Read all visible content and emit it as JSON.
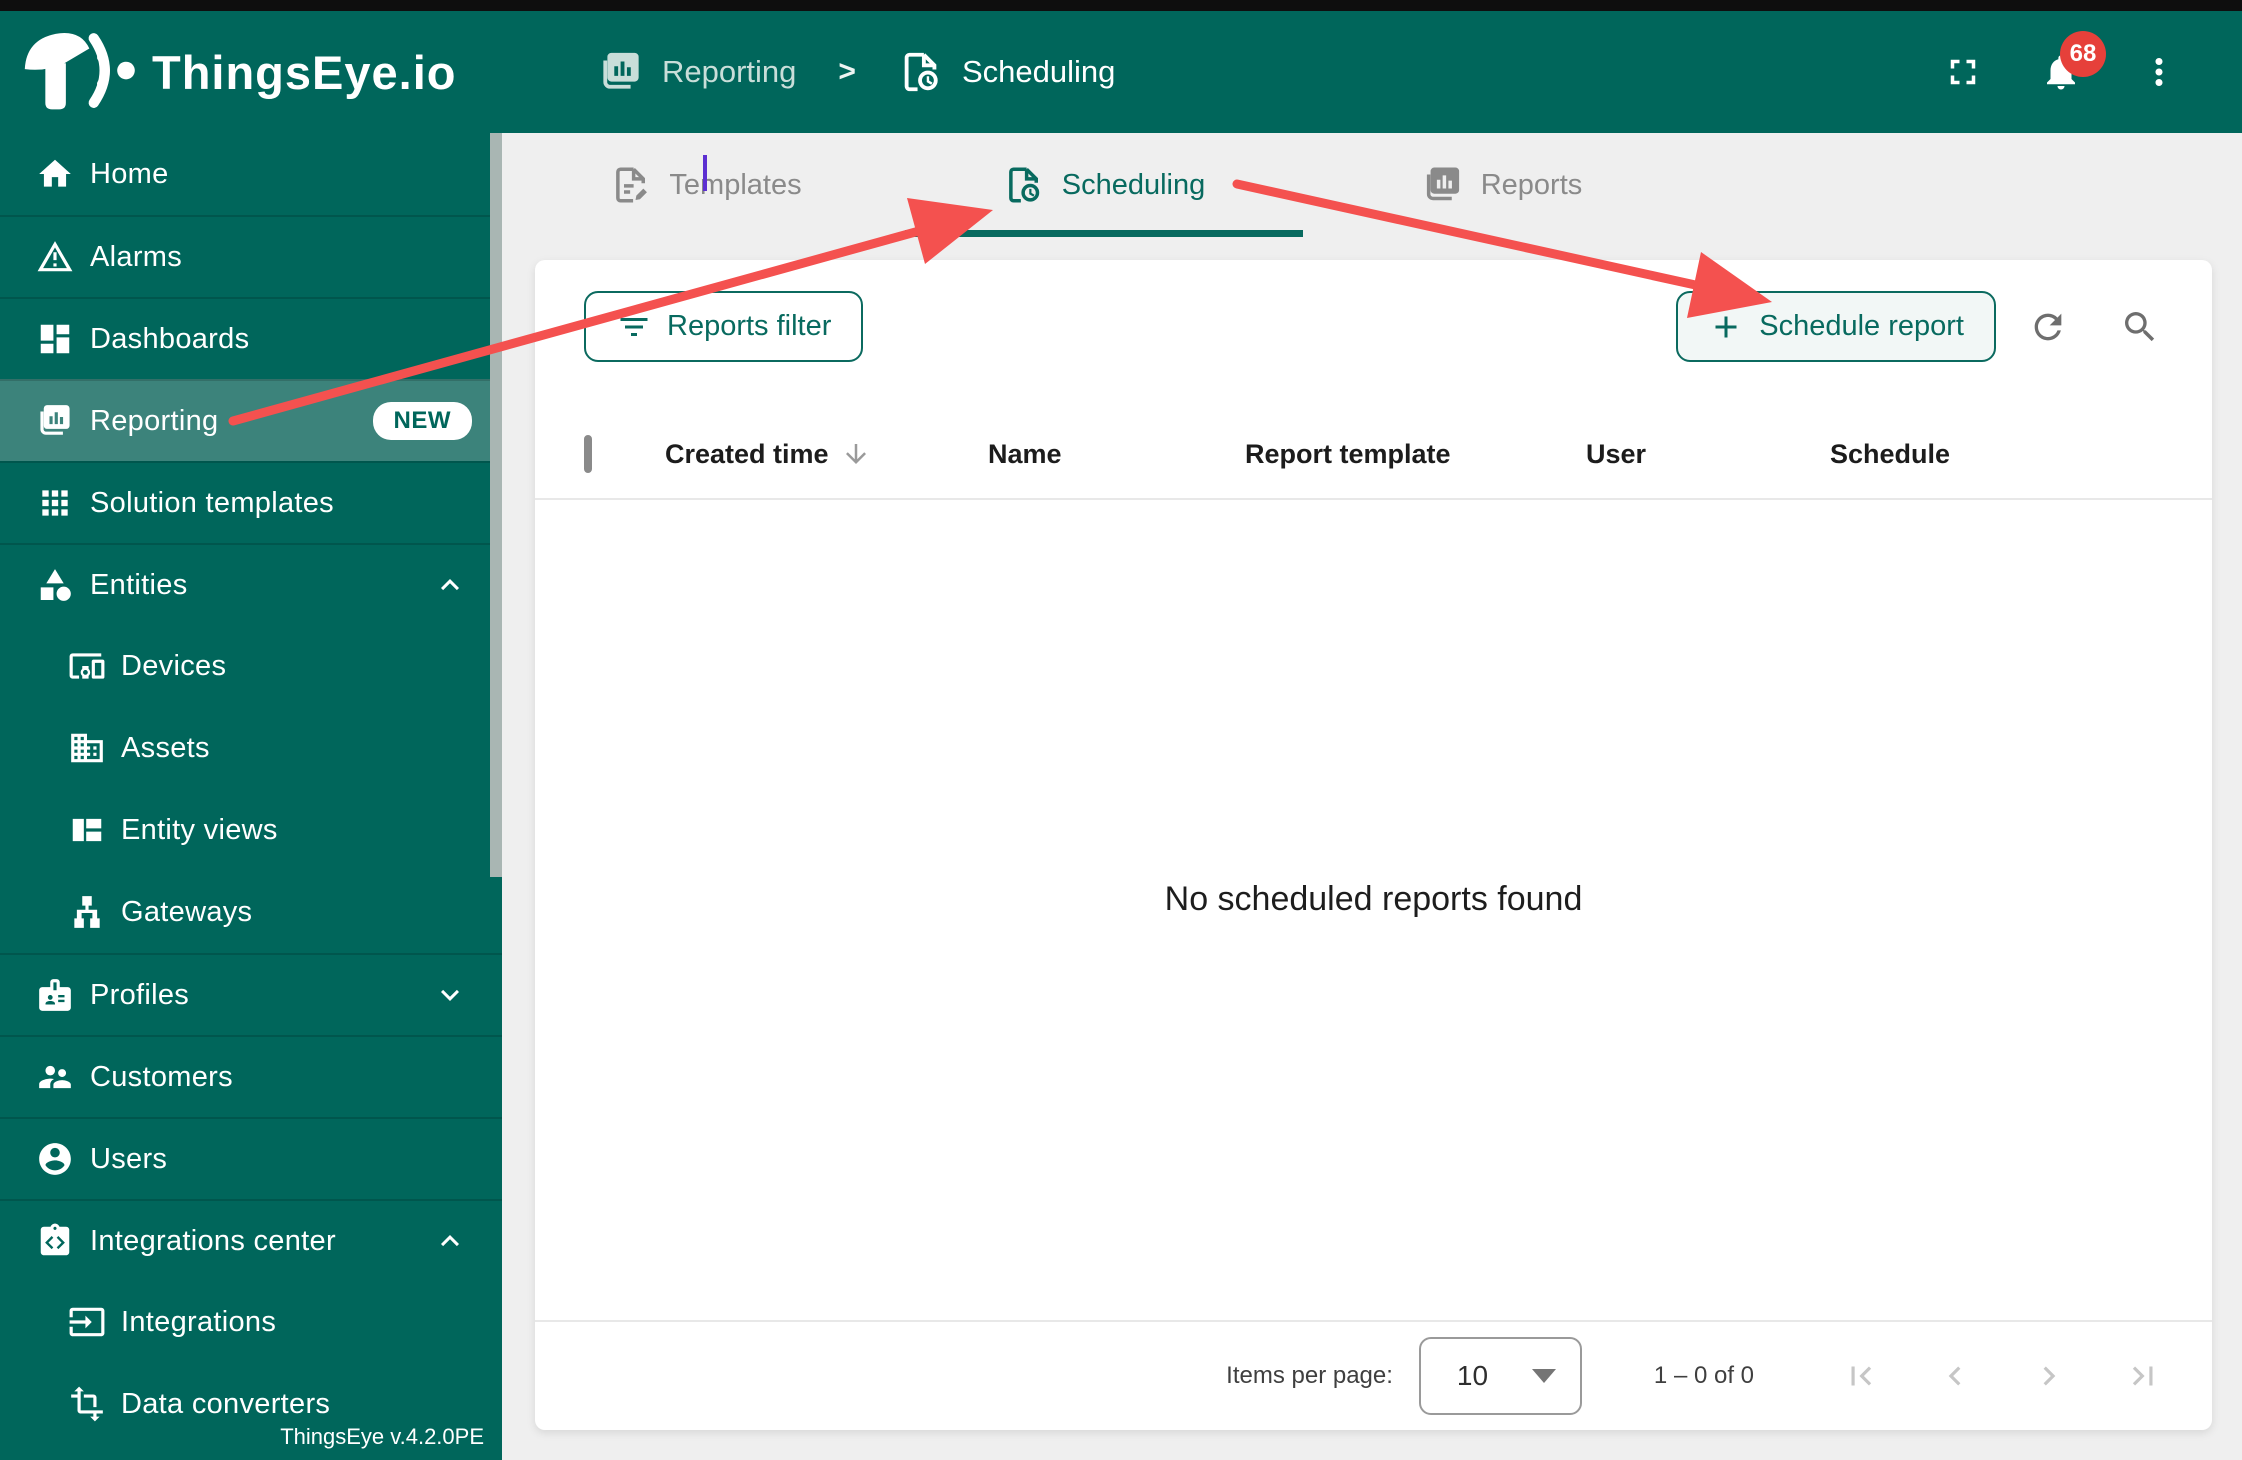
{
  "header": {
    "logo_text": "ThingsEye.io",
    "breadcrumb": {
      "items": [
        {
          "label": "Reporting",
          "icon": "reporting-icon"
        },
        {
          "label": "Scheduling",
          "icon": "scheduling-icon"
        }
      ],
      "separator": ">"
    },
    "notifications_count": "68",
    "icons": [
      "fullscreen-icon",
      "bell-icon",
      "more-vert-icon"
    ]
  },
  "sidebar": {
    "items": [
      {
        "label": "Home",
        "icon": "home-icon"
      },
      {
        "label": "Alarms",
        "icon": "alarms-icon"
      },
      {
        "label": "Dashboards",
        "icon": "dashboards-icon"
      },
      {
        "label": "Reporting",
        "icon": "reporting-icon",
        "badge": "NEW",
        "selected": true
      },
      {
        "label": "Solution templates",
        "icon": "solution-templates-icon"
      },
      {
        "label": "Entities",
        "icon": "entities-icon",
        "expanded": true
      },
      {
        "label": "Devices",
        "icon": "devices-icon",
        "indent": true
      },
      {
        "label": "Assets",
        "icon": "assets-icon",
        "indent": true
      },
      {
        "label": "Entity views",
        "icon": "entity-views-icon",
        "indent": true
      },
      {
        "label": "Gateways",
        "icon": "gateways-icon",
        "indent": true
      },
      {
        "label": "Profiles",
        "icon": "profiles-icon",
        "expanded": false
      },
      {
        "label": "Customers",
        "icon": "customers-icon"
      },
      {
        "label": "Users",
        "icon": "users-icon"
      },
      {
        "label": "Integrations center",
        "icon": "integrations-center-icon",
        "expanded": true
      },
      {
        "label": "Integrations",
        "icon": "integrations-icon",
        "indent": true
      },
      {
        "label": "Data converters",
        "icon": "data-converters-icon",
        "indent": true
      }
    ],
    "version": "ThingsEye v.4.2.0PE"
  },
  "tabs": {
    "items": [
      {
        "label": "Templates",
        "icon": "templates-icon",
        "active": false
      },
      {
        "label": "Scheduling",
        "icon": "scheduling-icon",
        "active": true
      },
      {
        "label": "Reports",
        "icon": "reports-icon",
        "active": false
      }
    ]
  },
  "toolbar": {
    "reports_filter_label": "Reports filter",
    "schedule_report_label": "Schedule report"
  },
  "table": {
    "columns": {
      "created_time": "Created time",
      "name": "Name",
      "report_template": "Report template",
      "user": "User",
      "schedule": "Schedule"
    },
    "sort_column": "Created time",
    "sort_direction": "descending",
    "empty_message": "No scheduled reports found"
  },
  "paginator": {
    "items_per_page_label": "Items per page:",
    "page_size": "10",
    "range_label": "1 – 0 of 0"
  },
  "annotations": {
    "arrow_color": "#f4514f",
    "arrows": [
      "sidebar-reporting-to-scheduling-tab",
      "scheduling-tab-to-schedule-report-button"
    ]
  },
  "colors": {
    "primary_teal": "#00665b",
    "accent_teal": "#086a5f",
    "selected_item_bg": "#3c837b",
    "badge_red": "#e6403a",
    "arrow_red": "#f4514f",
    "content_bg": "#efefef",
    "new_badge_bg": "#ffffff"
  }
}
